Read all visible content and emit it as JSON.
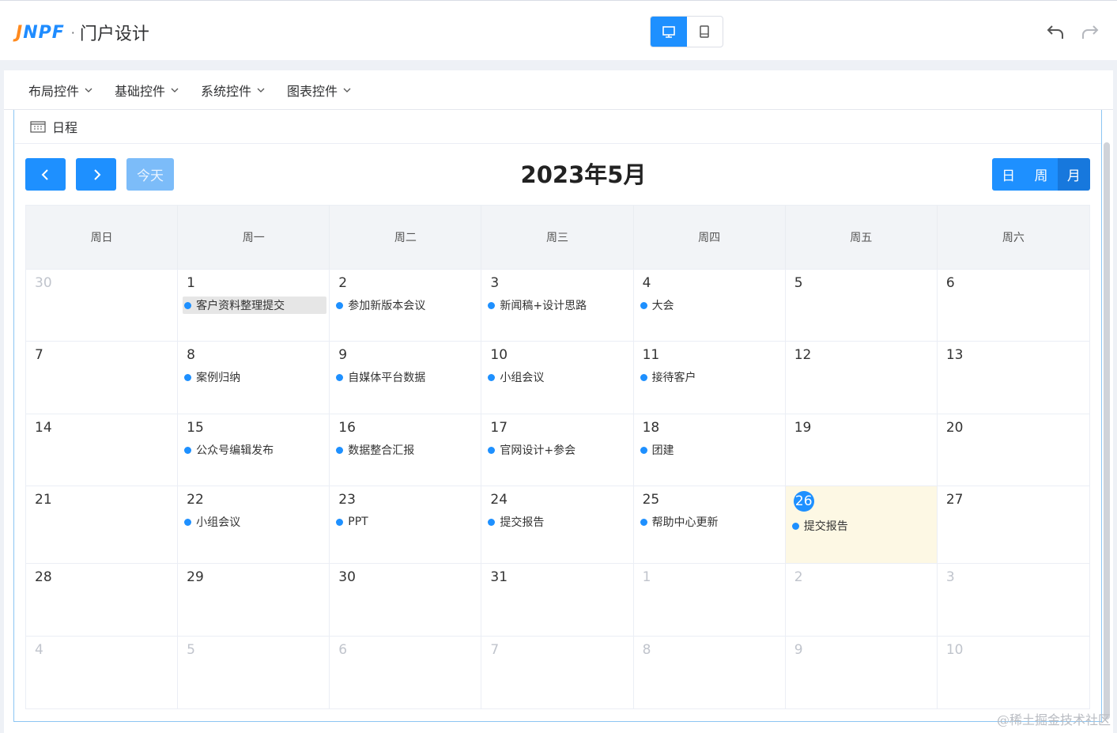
{
  "header": {
    "brand_j": "J",
    "brand_rest": "NPF",
    "separator": "·",
    "title": "门户设计",
    "colors": {
      "accent": "#1e90ff",
      "brand_orange": "#ff8a1e"
    }
  },
  "device_toggle": {
    "options": [
      {
        "icon": "desktop-icon",
        "active": true
      },
      {
        "icon": "tablet-icon",
        "active": false
      }
    ]
  },
  "menubar": {
    "items": [
      {
        "label": "布局控件"
      },
      {
        "label": "基础控件"
      },
      {
        "label": "系统控件"
      },
      {
        "label": "图表控件"
      }
    ]
  },
  "widget": {
    "title": "日程",
    "toolbar": {
      "today_label": "今天",
      "view_buttons": [
        {
          "label": "日",
          "active": false
        },
        {
          "label": "周",
          "active": false
        },
        {
          "label": "月",
          "active": true
        }
      ]
    },
    "calendar": {
      "title": "2023年5月",
      "weekdays": [
        "周日",
        "周一",
        "周二",
        "周三",
        "周四",
        "周五",
        "周六"
      ],
      "days": [
        {
          "n": "30",
          "other": true,
          "event": ""
        },
        {
          "n": "1",
          "other": false,
          "event": "客户资料整理提交",
          "highlight": true
        },
        {
          "n": "2",
          "other": false,
          "event": "参加新版本会议"
        },
        {
          "n": "3",
          "other": false,
          "event": "新闻稿+设计思路"
        },
        {
          "n": "4",
          "other": false,
          "event": "大会"
        },
        {
          "n": "5",
          "other": false,
          "event": ""
        },
        {
          "n": "6",
          "other": false,
          "event": ""
        },
        {
          "n": "7",
          "other": false,
          "event": ""
        },
        {
          "n": "8",
          "other": false,
          "event": "案例归纳"
        },
        {
          "n": "9",
          "other": false,
          "event": "自媒体平台数据"
        },
        {
          "n": "10",
          "other": false,
          "event": "小组会议"
        },
        {
          "n": "11",
          "other": false,
          "event": "接待客户"
        },
        {
          "n": "12",
          "other": false,
          "event": ""
        },
        {
          "n": "13",
          "other": false,
          "event": ""
        },
        {
          "n": "14",
          "other": false,
          "event": ""
        },
        {
          "n": "15",
          "other": false,
          "event": "公众号编辑发布"
        },
        {
          "n": "16",
          "other": false,
          "event": "数据整合汇报"
        },
        {
          "n": "17",
          "other": false,
          "event": "官网设计+参会"
        },
        {
          "n": "18",
          "other": false,
          "event": "团建"
        },
        {
          "n": "19",
          "other": false,
          "event": ""
        },
        {
          "n": "20",
          "other": false,
          "event": ""
        },
        {
          "n": "21",
          "other": false,
          "event": ""
        },
        {
          "n": "22",
          "other": false,
          "event": "小组会议"
        },
        {
          "n": "23",
          "other": false,
          "event": "PPT"
        },
        {
          "n": "24",
          "other": false,
          "event": "提交报告"
        },
        {
          "n": "25",
          "other": false,
          "event": "帮助中心更新"
        },
        {
          "n": "26",
          "other": false,
          "event": "提交报告",
          "today": true
        },
        {
          "n": "27",
          "other": false,
          "event": ""
        },
        {
          "n": "28",
          "other": false,
          "event": ""
        },
        {
          "n": "29",
          "other": false,
          "event": ""
        },
        {
          "n": "30",
          "other": false,
          "event": ""
        },
        {
          "n": "31",
          "other": false,
          "event": ""
        },
        {
          "n": "1",
          "other": true,
          "event": ""
        },
        {
          "n": "2",
          "other": true,
          "event": ""
        },
        {
          "n": "3",
          "other": true,
          "event": ""
        },
        {
          "n": "4",
          "other": true,
          "event": ""
        },
        {
          "n": "5",
          "other": true,
          "event": ""
        },
        {
          "n": "6",
          "other": true,
          "event": ""
        },
        {
          "n": "7",
          "other": true,
          "event": ""
        },
        {
          "n": "8",
          "other": true,
          "event": ""
        },
        {
          "n": "9",
          "other": true,
          "event": ""
        },
        {
          "n": "10",
          "other": true,
          "event": ""
        }
      ]
    }
  },
  "watermark": "@稀土掘金技术社区"
}
